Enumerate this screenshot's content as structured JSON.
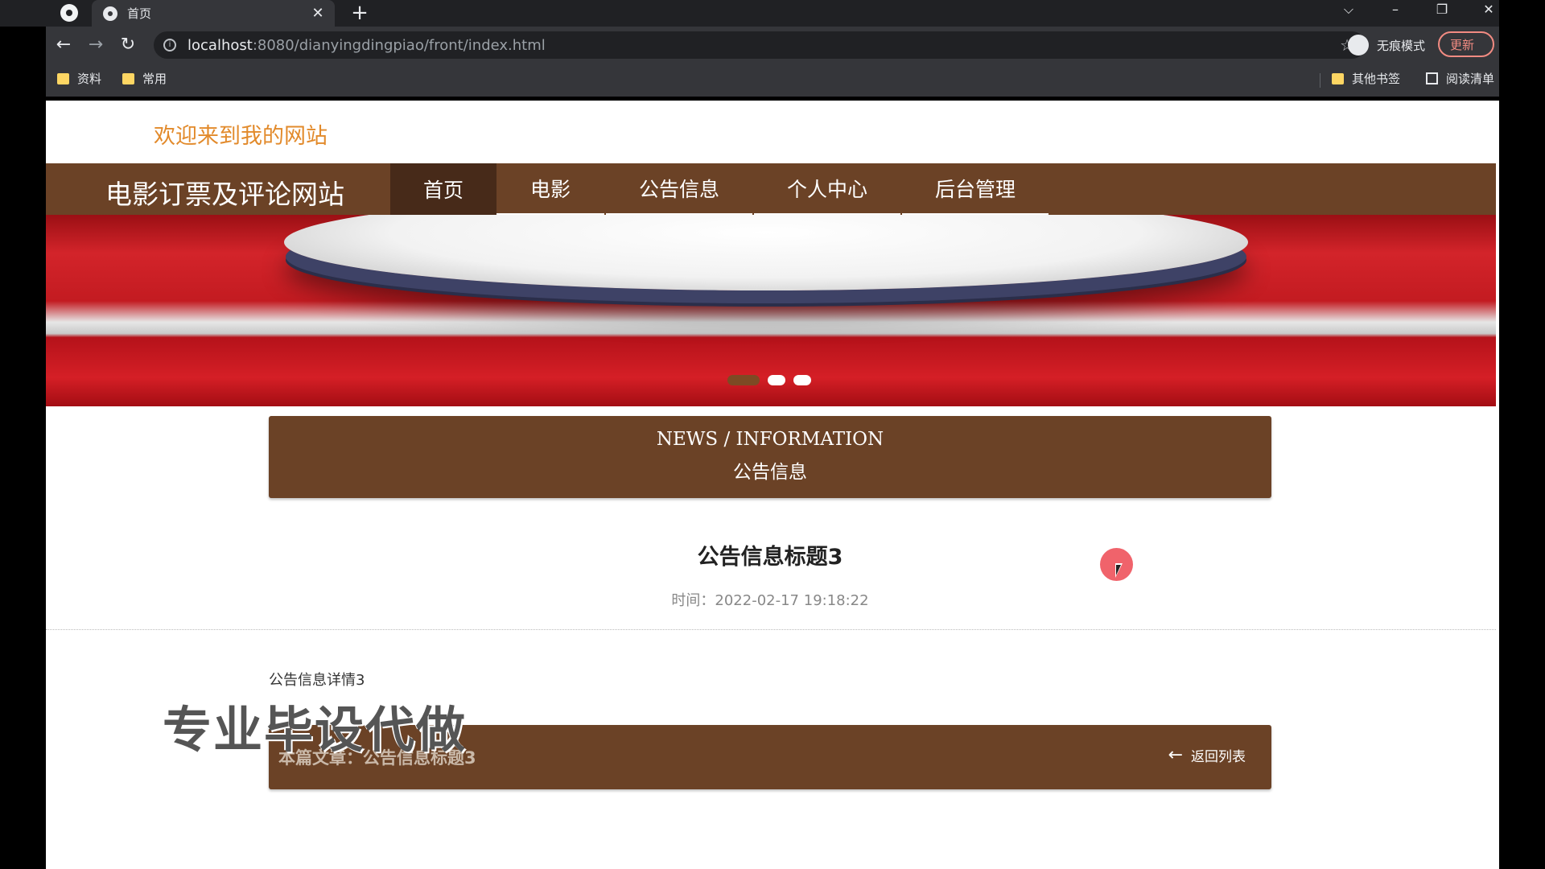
{
  "browser": {
    "tab_title": "首页",
    "url_host": "localhost",
    "url_rest": ":8080/dianyingdingpiao/front/index.html",
    "incognito_label": "无痕模式",
    "update_label": "更新",
    "bookmarks": {
      "left": [
        "资料",
        "常用"
      ],
      "other": "其他书签",
      "reading_list": "阅读清单"
    }
  },
  "site": {
    "welcome": "欢迎来到我的网站",
    "title": "电影订票及评论网站",
    "nav": [
      "首页",
      "电影",
      "公告信息",
      "个人中心",
      "后台管理"
    ],
    "active_nav": "首页"
  },
  "banner": {
    "slide_count": 3,
    "active_slide": 1
  },
  "news_section": {
    "heading_en": "NEWS / INFORMATION",
    "heading_cn": "公告信息"
  },
  "article": {
    "title": "公告信息标题3",
    "time_label": "时间：",
    "time": "2022-02-17 19:18:22",
    "body": "公告信息详情3",
    "current_label": "本篇文章：公告信息标题3",
    "back_label": "返回列表"
  },
  "watermark": "专业毕设代做",
  "colors": {
    "nav_bg": "#6b4226",
    "nav_active": "#472a19",
    "welcome": "#e28a2b",
    "banner_red": "#d3242a"
  }
}
